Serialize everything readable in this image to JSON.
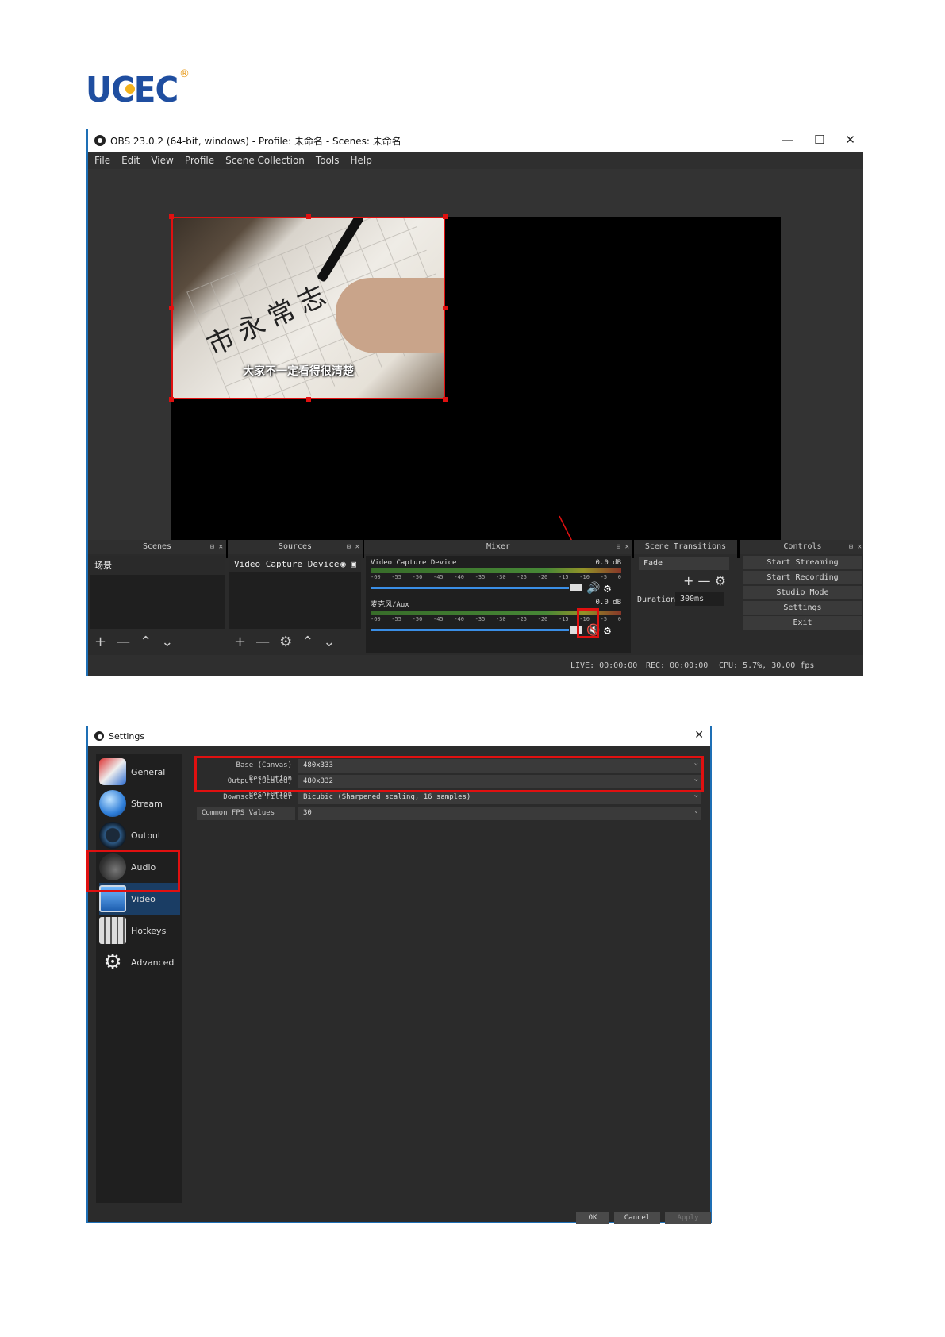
{
  "logo": {
    "text": "UCEC",
    "reg": "®"
  },
  "obs": {
    "title": "OBS 23.0.2 (64-bit, windows) - Profile: 未命名 - Scenes: 未命名",
    "window_controls": [
      "—",
      "☐",
      "✕"
    ],
    "menu": [
      "File",
      "Edit",
      "View",
      "Profile",
      "Scene Collection",
      "Tools",
      "Help"
    ],
    "preview": {
      "subtitle": "大家不一定看得很清楚",
      "chars": "市永常志"
    },
    "docks": {
      "scenes": {
        "title": "Scenes",
        "items": [
          "场景"
        ]
      },
      "sources": {
        "title": "Sources",
        "items": [
          "Video Capture Device"
        ]
      },
      "mixer": {
        "title": "Mixer",
        "channels": [
          {
            "name": "Video Capture Device",
            "db": "0.0 dB",
            "muted": false
          },
          {
            "name": "麦克风/Aux",
            "db": "0.0 dB",
            "muted": true
          }
        ],
        "ticks": [
          "-60",
          "-55",
          "-50",
          "-45",
          "-40",
          "-35",
          "-30",
          "-25",
          "-20",
          "-15",
          "-10",
          "-5",
          "0"
        ]
      },
      "transitions": {
        "title": "Scene Transitions",
        "selected": "Fade",
        "duration_label": "Duration",
        "duration_value": "300ms"
      },
      "controls": {
        "title": "Controls",
        "buttons": [
          "Start Streaming",
          "Start Recording",
          "Studio Mode",
          "Settings",
          "Exit"
        ]
      }
    },
    "status": {
      "live": "LIVE: 00:00:00",
      "rec": "REC: 00:00:00",
      "cpu": "CPU: 5.7%, 30.00 fps"
    }
  },
  "settings": {
    "title": "Settings",
    "sidebar": [
      "General",
      "Stream",
      "Output",
      "Audio",
      "Video",
      "Hotkeys",
      "Advanced"
    ],
    "active": "Video",
    "rows": [
      {
        "label": "Base (Canvas) Resolution",
        "value": "480x333"
      },
      {
        "label": "Output (Scaled) Resolution",
        "value": "480x332"
      },
      {
        "label": "Downscale Filter",
        "value": "Bicubic (Sharpened scaling, 16 samples)"
      },
      {
        "label": "Common FPS Values",
        "value": "30"
      }
    ],
    "buttons": [
      "OK",
      "Cancel",
      "Apply"
    ]
  },
  "colors": {
    "highlight": "#e01010",
    "obs_bg": "#2b2b2b",
    "logo_blue": "#1f4ea0",
    "logo_orange": "#f3b21c"
  }
}
